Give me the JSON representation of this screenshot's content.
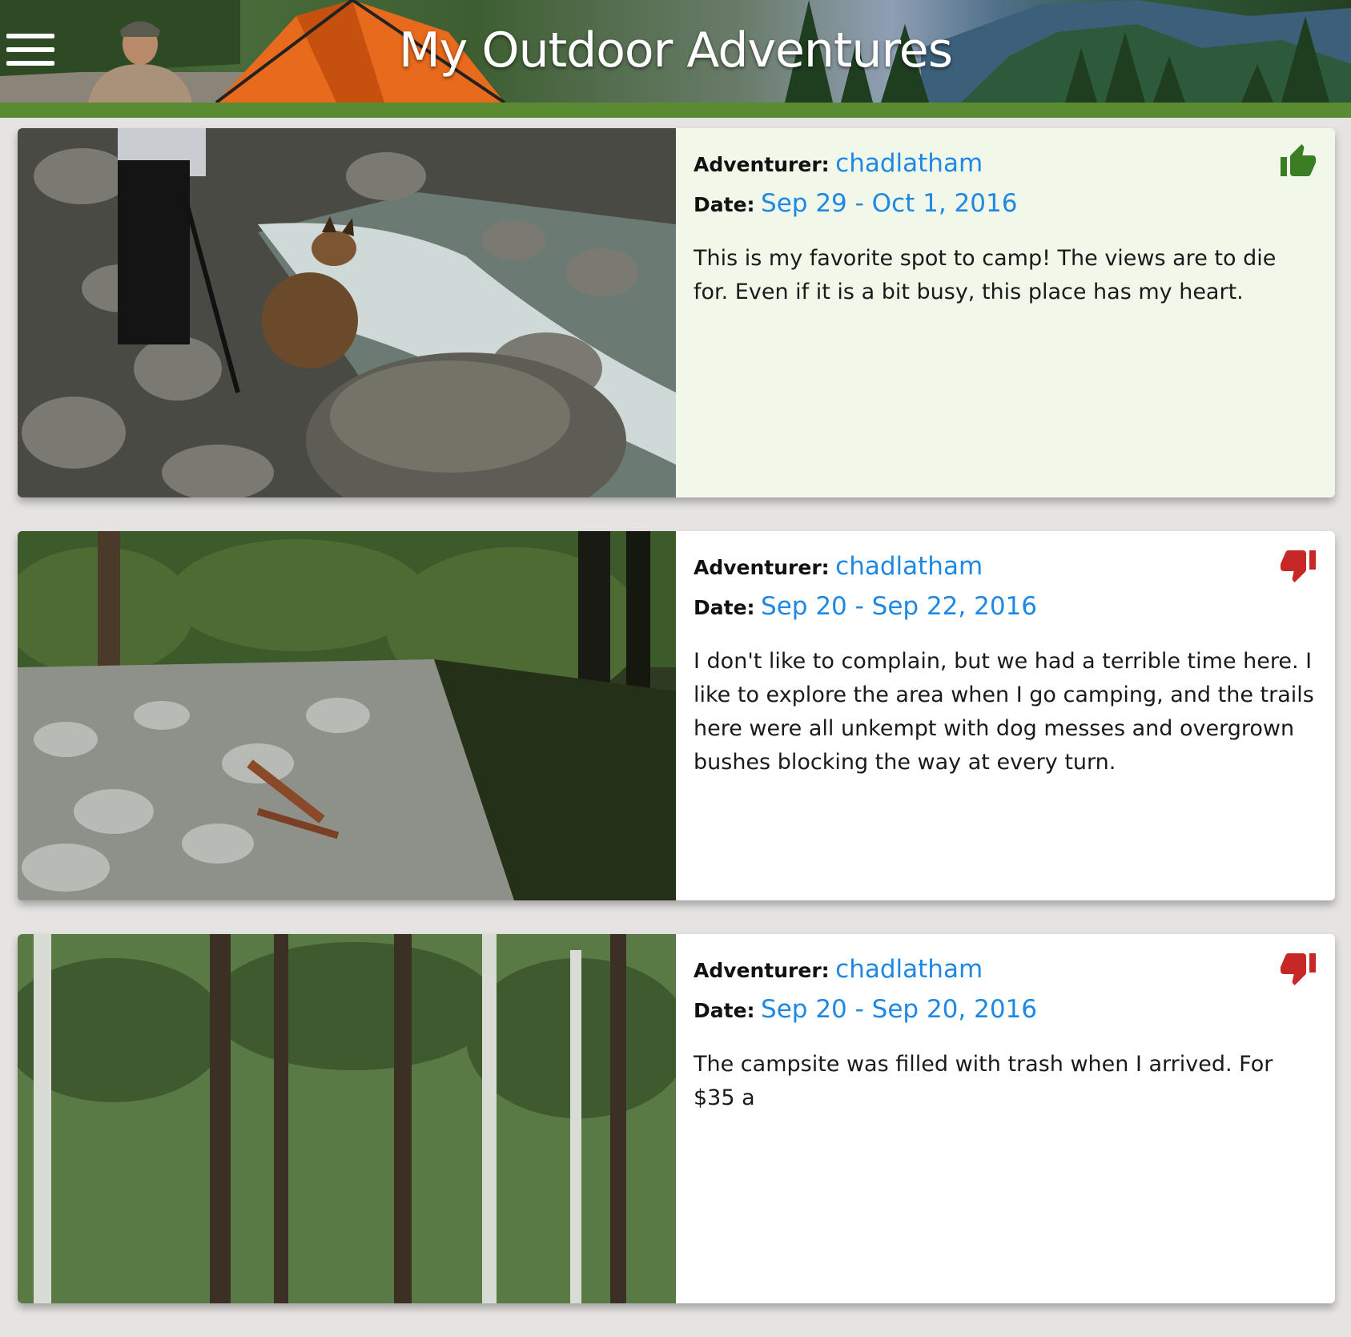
{
  "header": {
    "title": "My Outdoor Adventures",
    "menu_icon": "hamburger-menu-icon",
    "accent_color": "#5a8a32"
  },
  "labels": {
    "adventurer": "Adventurer:",
    "date": "Date:"
  },
  "colors": {
    "link": "#1e88e5",
    "thumbs_up": "#3b7d23",
    "thumbs_down": "#c62828",
    "liked_card_bg": "#f1f8e9"
  },
  "entries": [
    {
      "adventurer": "chadlatham",
      "date": "Sep 29 - Oct 1, 2016",
      "description": "This is my favorite spot to camp! The views are to die for. Even if it is a bit busy, this place has my heart.",
      "rating": "thumbs-up",
      "rating_icon": "thumbs-up-icon",
      "photo": "rocky-creek-with-dog-photo"
    },
    {
      "adventurer": "chadlatham",
      "date": "Sep 20 - Sep 22, 2016",
      "description": "I don't like to complain, but we had a terrible time here. I like to explore the area when I go camping, and the trails here were all unkempt with dog messes and overgrown bushes blocking the way at every turn.",
      "rating": "thumbs-down",
      "rating_icon": "thumbs-down-icon",
      "photo": "forest-stream-photo"
    },
    {
      "adventurer": "chadlatham",
      "date": "Sep 20 - Sep 20, 2016",
      "description": "The campsite was filled with trash when I arrived. For $35 a",
      "rating": "thumbs-down",
      "rating_icon": "thumbs-down-icon",
      "photo": "mossy-forest-photo"
    }
  ]
}
